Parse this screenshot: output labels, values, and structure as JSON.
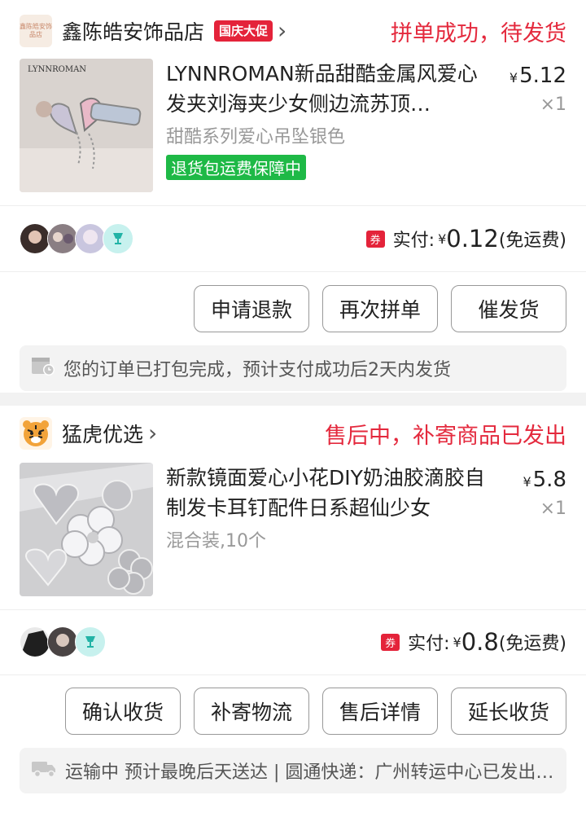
{
  "orders": [
    {
      "shop": {
        "name": "鑫陈皓安饰品店",
        "logo_text": "鑫陈皓安饰品店",
        "promo_badge": "国庆大促"
      },
      "status": "拼单成功，待发货",
      "product": {
        "thumb_text": "LYNNROMAN",
        "title": "LYNNROMAN新品甜酷金属风爱心发夹刘海夹少女侧边流苏顶…",
        "price_symbol": "¥",
        "price": "5.12",
        "qty": "×1",
        "sku": "甜酷系列爱心吊坠银色",
        "guarantee": "退货包运费保障中"
      },
      "payment": {
        "coupon_label": "券",
        "label": "实付:",
        "currency": "¥",
        "amount": "0.12",
        "shipping_note": "(免运费)"
      },
      "actions": [
        "申请退款",
        "再次拼单",
        "催发货"
      ],
      "notice": "您的订单已打包完成，预计支付成功后2天内发货"
    },
    {
      "shop": {
        "name": "猛虎优选"
      },
      "status": "售后中，补寄商品已发出",
      "product": {
        "title": "新款镜面爱心小花DIY奶油胶滴胶自制发卡耳钉配件日系超仙少女",
        "price_symbol": "¥",
        "price": "5.8",
        "qty": "×1",
        "sku": "混合装,10个"
      },
      "payment": {
        "coupon_label": "券",
        "label": "实付:",
        "currency": "¥",
        "amount": "0.8",
        "shipping_note": "(免运费)"
      },
      "actions": [
        "确认收货",
        "补寄物流",
        "售后详情",
        "延长收货"
      ],
      "notice": "运输中 预计最晚后天送达 | 圆通快递：广州转运中心已发出，下一站…"
    }
  ],
  "icons": {
    "chevron": "chevron-right-icon",
    "package_notice": "package-notice-icon",
    "truck": "truck-icon",
    "cup": "cup-icon"
  },
  "colors": {
    "status_red": "#e4293d",
    "promo_red": "#e4233a",
    "guarantee_green": "#1eb946",
    "cup_bg": "#c7f1ee"
  }
}
